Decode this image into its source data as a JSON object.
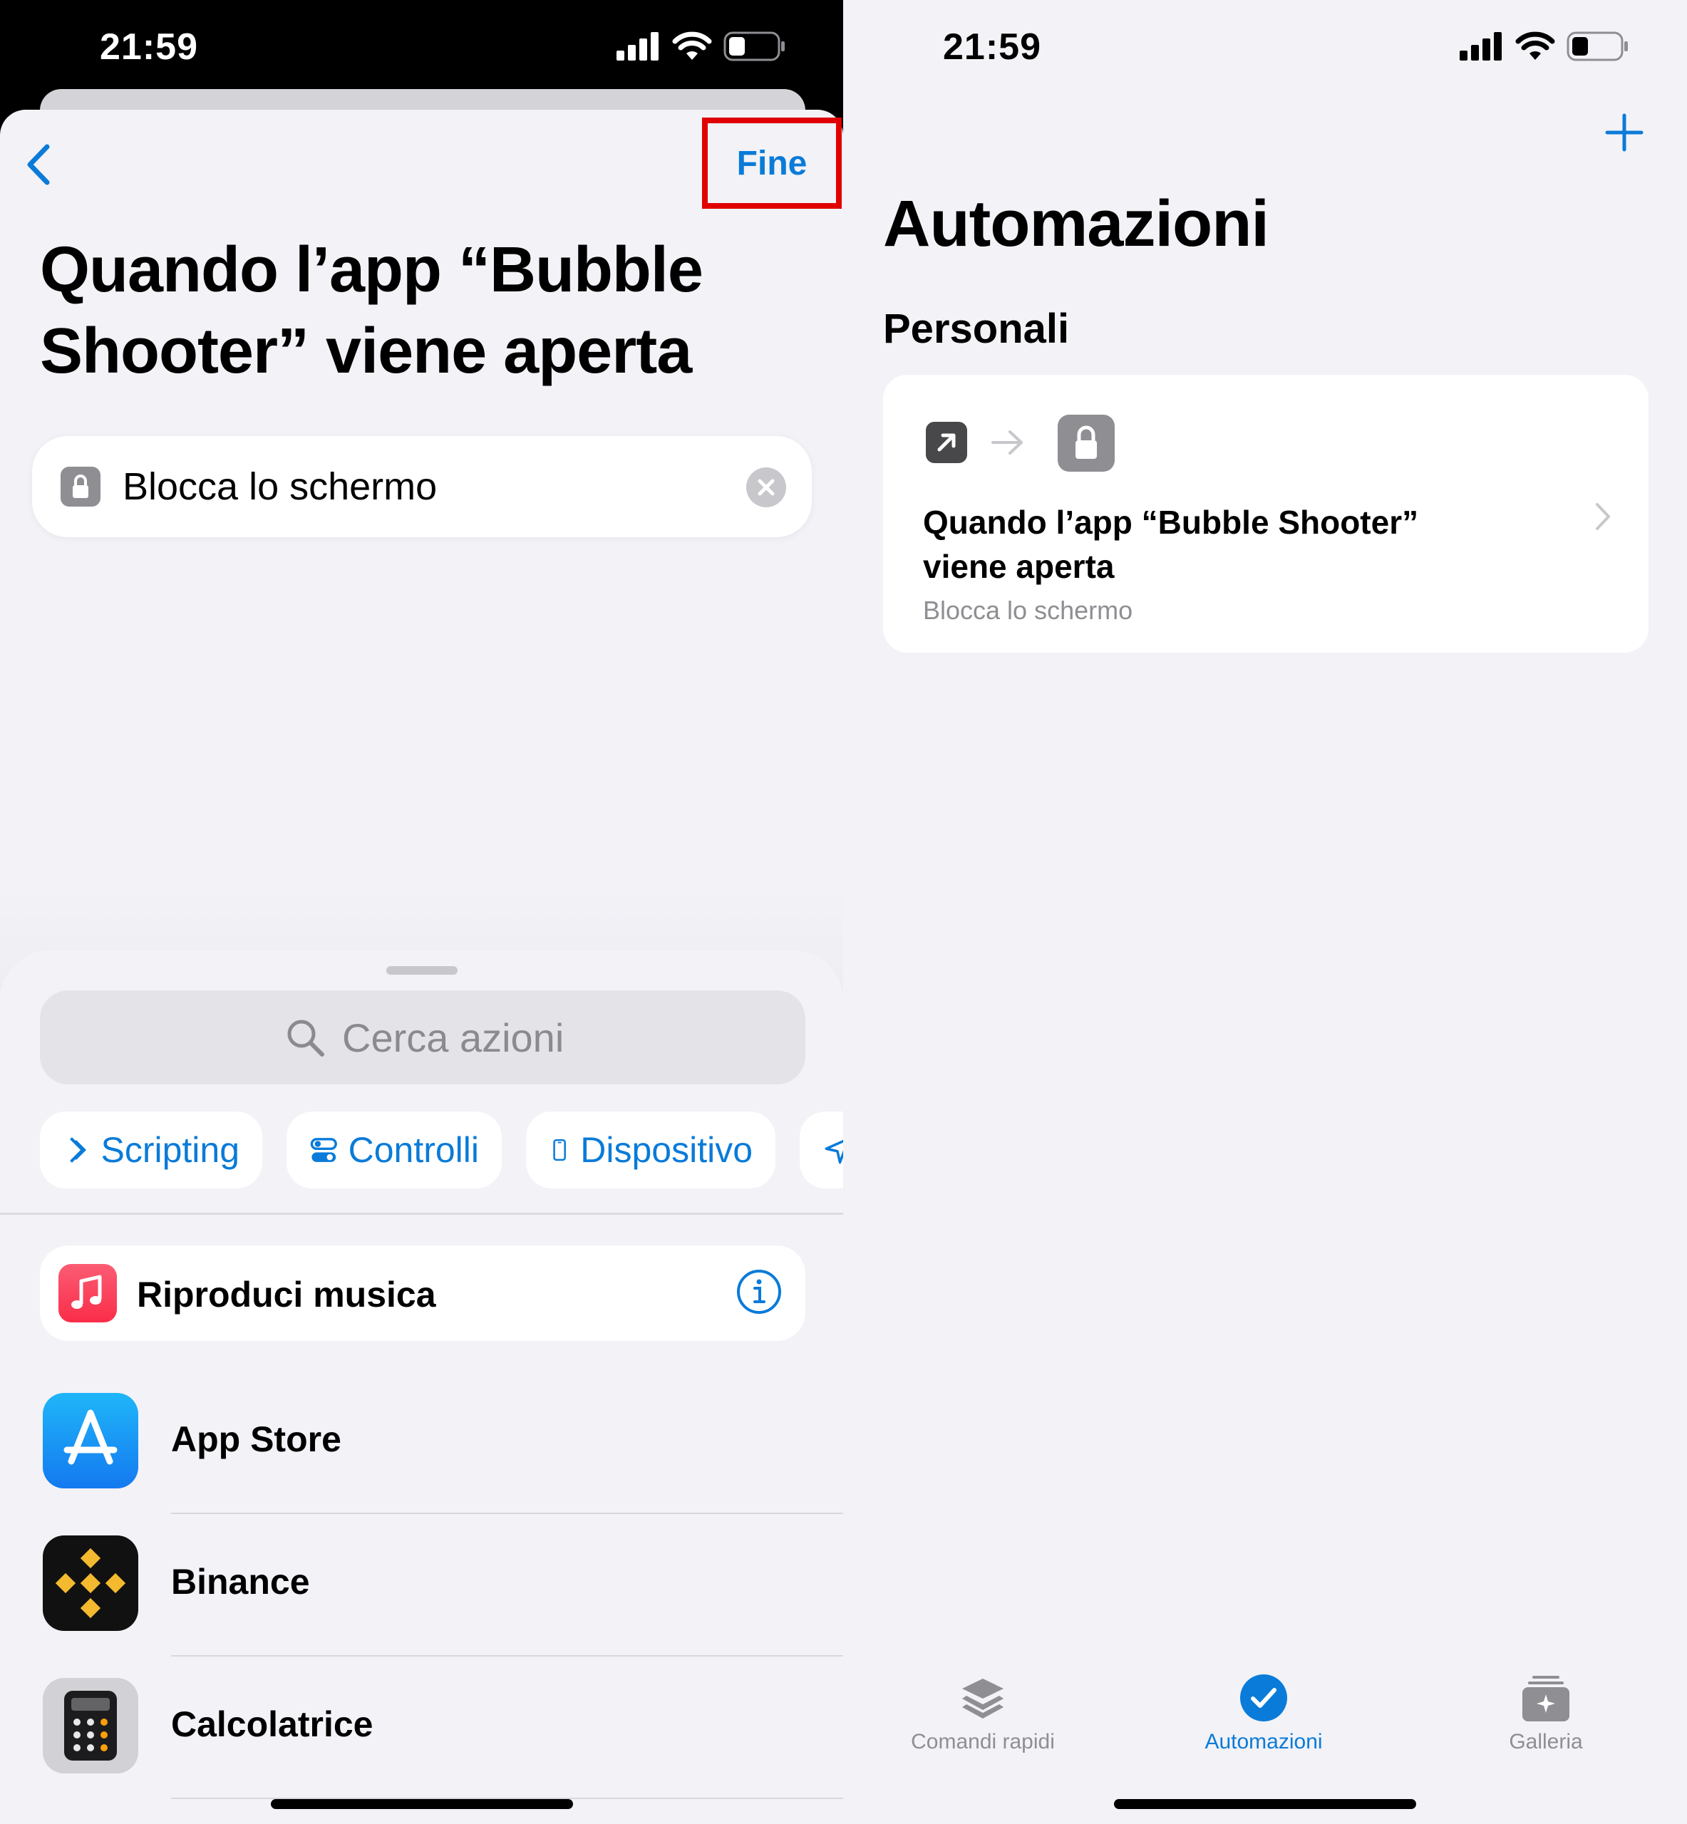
{
  "status_bar": {
    "time": "21:59"
  },
  "left": {
    "done_button": "Fine",
    "title": "Quando l’app “Bubble Shooter” viene aperta",
    "action": {
      "label": "Blocca lo schermo",
      "icon": "lock-icon"
    },
    "search": {
      "placeholder": "Cerca azioni"
    },
    "categories": [
      {
        "label": "Scripting",
        "icon": "scripting-icon"
      },
      {
        "label": "Controlli",
        "icon": "controls-icon"
      },
      {
        "label": "Dispositivo",
        "icon": "device-icon"
      },
      {
        "label": "",
        "icon": "location-icon"
      }
    ],
    "suggestion": {
      "label": "Riproduci musica",
      "icon": "music-icon"
    },
    "apps": [
      {
        "label": "App Store",
        "icon": "app-store-icon"
      },
      {
        "label": "Binance",
        "icon": "binance-icon"
      },
      {
        "label": "Calcolatrice",
        "icon": "calculator-icon"
      }
    ]
  },
  "right": {
    "title": "Automazioni",
    "section": "Personali",
    "card": {
      "title": "Quando l’app “Bubble Shooter” viene aperta",
      "subtitle": "Blocca lo schermo"
    },
    "tabs": [
      {
        "label": "Comandi rapidi",
        "icon": "shortcuts-icon",
        "active": false
      },
      {
        "label": "Automazioni",
        "icon": "automation-icon",
        "active": true
      },
      {
        "label": "Galleria",
        "icon": "gallery-icon",
        "active": false
      }
    ]
  },
  "colors": {
    "accent": "#0a7bd8",
    "highlight": "#e00000"
  }
}
